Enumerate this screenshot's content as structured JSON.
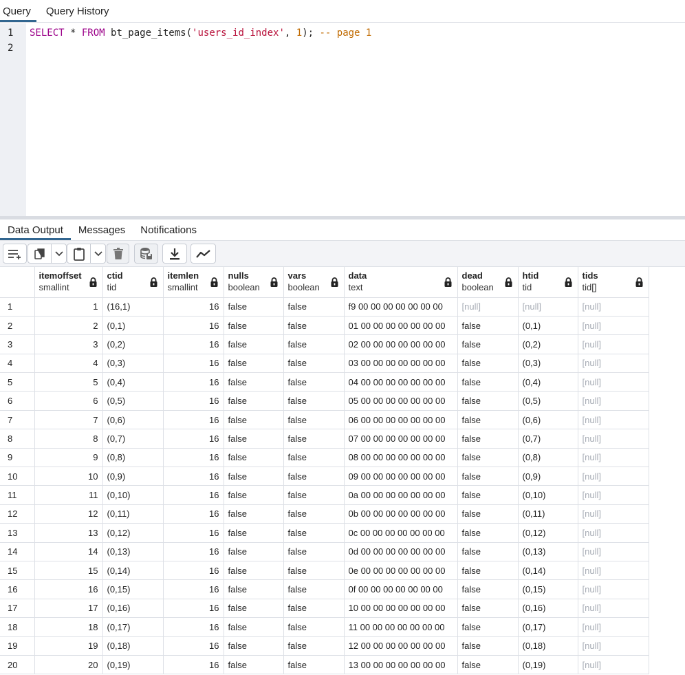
{
  "top_tabs": {
    "query": "Query",
    "history": "Query History"
  },
  "editor": {
    "line1_num": "1",
    "line2_num": "2",
    "sql": {
      "kw_select": "SELECT",
      "star": " * ",
      "kw_from": "FROM",
      "fn": " bt_page_items(",
      "str": "'users_id_index'",
      "comma": ", ",
      "num": "1",
      "close": "); ",
      "comment": "-- page 1"
    }
  },
  "result_tabs": {
    "data_output": "Data Output",
    "messages": "Messages",
    "notifications": "Notifications"
  },
  "toolbar_icons": [
    "add-row-icon",
    "copy-icon",
    "chevron-down-icon",
    "paste-icon",
    "chevron-down-icon",
    "delete-icon",
    "save-data-icon",
    "download-icon",
    "graph-icon"
  ],
  "columns": [
    {
      "name": "itemoffset",
      "type": "smallint"
    },
    {
      "name": "ctid",
      "type": "tid"
    },
    {
      "name": "itemlen",
      "type": "smallint"
    },
    {
      "name": "nulls",
      "type": "boolean"
    },
    {
      "name": "vars",
      "type": "boolean"
    },
    {
      "name": "data",
      "type": "text"
    },
    {
      "name": "dead",
      "type": "boolean"
    },
    {
      "name": "htid",
      "type": "tid"
    },
    {
      "name": "tids",
      "type": "tid[]"
    }
  ],
  "rows": [
    [
      "1",
      "1",
      "(16,1)",
      "16",
      "false",
      "false",
      "f9 00 00 00 00 00 00 00",
      "[null]",
      "[null]",
      "[null]"
    ],
    [
      "2",
      "2",
      "(0,1)",
      "16",
      "false",
      "false",
      "01 00 00 00 00 00 00 00",
      "false",
      "(0,1)",
      "[null]"
    ],
    [
      "3",
      "3",
      "(0,2)",
      "16",
      "false",
      "false",
      "02 00 00 00 00 00 00 00",
      "false",
      "(0,2)",
      "[null]"
    ],
    [
      "4",
      "4",
      "(0,3)",
      "16",
      "false",
      "false",
      "03 00 00 00 00 00 00 00",
      "false",
      "(0,3)",
      "[null]"
    ],
    [
      "5",
      "5",
      "(0,4)",
      "16",
      "false",
      "false",
      "04 00 00 00 00 00 00 00",
      "false",
      "(0,4)",
      "[null]"
    ],
    [
      "6",
      "6",
      "(0,5)",
      "16",
      "false",
      "false",
      "05 00 00 00 00 00 00 00",
      "false",
      "(0,5)",
      "[null]"
    ],
    [
      "7",
      "7",
      "(0,6)",
      "16",
      "false",
      "false",
      "06 00 00 00 00 00 00 00",
      "false",
      "(0,6)",
      "[null]"
    ],
    [
      "8",
      "8",
      "(0,7)",
      "16",
      "false",
      "false",
      "07 00 00 00 00 00 00 00",
      "false",
      "(0,7)",
      "[null]"
    ],
    [
      "9",
      "9",
      "(0,8)",
      "16",
      "false",
      "false",
      "08 00 00 00 00 00 00 00",
      "false",
      "(0,8)",
      "[null]"
    ],
    [
      "10",
      "10",
      "(0,9)",
      "16",
      "false",
      "false",
      "09 00 00 00 00 00 00 00",
      "false",
      "(0,9)",
      "[null]"
    ],
    [
      "11",
      "11",
      "(0,10)",
      "16",
      "false",
      "false",
      "0a 00 00 00 00 00 00 00",
      "false",
      "(0,10)",
      "[null]"
    ],
    [
      "12",
      "12",
      "(0,11)",
      "16",
      "false",
      "false",
      "0b 00 00 00 00 00 00 00",
      "false",
      "(0,11)",
      "[null]"
    ],
    [
      "13",
      "13",
      "(0,12)",
      "16",
      "false",
      "false",
      "0c 00 00 00 00 00 00 00",
      "false",
      "(0,12)",
      "[null]"
    ],
    [
      "14",
      "14",
      "(0,13)",
      "16",
      "false",
      "false",
      "0d 00 00 00 00 00 00 00",
      "false",
      "(0,13)",
      "[null]"
    ],
    [
      "15",
      "15",
      "(0,14)",
      "16",
      "false",
      "false",
      "0e 00 00 00 00 00 00 00",
      "false",
      "(0,14)",
      "[null]"
    ],
    [
      "16",
      "16",
      "(0,15)",
      "16",
      "false",
      "false",
      "0f 00 00 00 00 00 00 00",
      "false",
      "(0,15)",
      "[null]"
    ],
    [
      "17",
      "17",
      "(0,16)",
      "16",
      "false",
      "false",
      "10 00 00 00 00 00 00 00",
      "false",
      "(0,16)",
      "[null]"
    ],
    [
      "18",
      "18",
      "(0,17)",
      "16",
      "false",
      "false",
      "11 00 00 00 00 00 00 00",
      "false",
      "(0,17)",
      "[null]"
    ],
    [
      "19",
      "19",
      "(0,18)",
      "16",
      "false",
      "false",
      "12 00 00 00 00 00 00 00",
      "false",
      "(0,18)",
      "[null]"
    ],
    [
      "20",
      "20",
      "(0,19)",
      "16",
      "false",
      "false",
      "13 00 00 00 00 00 00 00",
      "false",
      "(0,19)",
      "[null]"
    ]
  ]
}
